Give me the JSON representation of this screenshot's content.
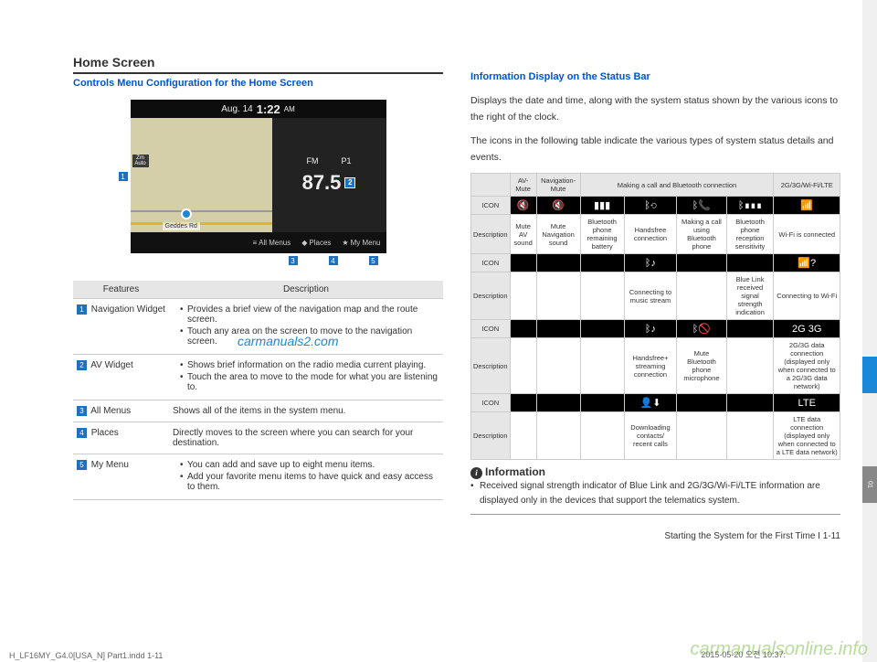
{
  "left": {
    "section_title": "Home Screen",
    "subtitle": "Controls Menu Configuration for the Home Screen",
    "screenshot": {
      "date": "Aug. 14",
      "time": "1:22",
      "ampm": "AM",
      "band": "FM",
      "preset": "P1",
      "freq": "87.5",
      "road": "Geddes Rd",
      "zoom": "Zm Auto",
      "bottom": {
        "allmenus": "All Menus",
        "places": "Places",
        "mymenu": "My Menu"
      }
    },
    "table": {
      "h1": "Features",
      "h2": "Description",
      "rows": [
        {
          "num": "1",
          "name": "Navigation Widget",
          "bullets": [
            "Provides a brief view of the navigation map and the route screen.",
            "Touch any area on the screen to move to the navigation screen."
          ]
        },
        {
          "num": "2",
          "name": "AV Widget",
          "bullets": [
            "Shows brief information on the radio media current playing.",
            "Touch the area to move to the mode for what you are listening to."
          ]
        },
        {
          "num": "3",
          "name": "All Menus",
          "text": "Shows all of the items in the system menu."
        },
        {
          "num": "4",
          "name": "Places",
          "text": "Directly moves to the screen where you can search for your destination."
        },
        {
          "num": "5",
          "name": "My Menu",
          "bullets": [
            "You can add and save up to eight menu items.",
            "Add your favorite menu items to have quick and easy access to them."
          ]
        }
      ]
    }
  },
  "right": {
    "subtitle": "Information Display on the Status Bar",
    "para1": "Displays the date and time, along with the system status shown by the various icons to the right of the clock.",
    "para2": "The icons in the following table indicate the various types of system status details and events.",
    "status_headers": {
      "avmute": "AV-Mute",
      "navmute": "Navigation-Mute",
      "calling": "Making a call and Bluetooth connection",
      "wifi": "2G/3G/Wi-Fi/LTE",
      "icon": "ICON",
      "desc": "Description"
    },
    "rows": [
      {
        "desc": [
          "Mute AV sound",
          "Mute Navigation sound",
          "Bluetooth phone remaining battery",
          "Handsfree connection",
          "Making a call using Bluetooth phone",
          "Bluetooth phone reception sensitivity",
          "Wi-Fi is connected"
        ]
      },
      {
        "desc": [
          "",
          "",
          "",
          "Connecting to music stream",
          "",
          "Blue Link received signal strength indication",
          "Connecting to Wi-Fi"
        ]
      },
      {
        "desc": [
          "",
          "",
          "",
          "Handsfree+ streaming connection",
          "Mute Bluetooth phone microphone",
          "",
          "2G/3G data connection (displayed only when connected to a 2G/3G data network)"
        ]
      },
      {
        "desc": [
          "",
          "",
          "",
          "Downloading contacts/ recent calls",
          "",
          "",
          "LTE data connection (displayed only when connected to a LTE  data network)"
        ]
      }
    ],
    "info_label": "Information",
    "info_text": "Received signal strength indicator of Blue Link and 2G/3G/Wi-Fi/LTE information are displayed only in the devices that support the telematics system.",
    "footer": "Starting the System for the First Time I 1-11"
  },
  "watermark": "carmanuals2.com",
  "watermark2": "carmanualsonline.info",
  "printmark": "H_LF16MY_G4.0[USA_N] Part1.indd   1-11",
  "printdate": "2015-05-20   오전 10:37:",
  "sidetab": "01"
}
